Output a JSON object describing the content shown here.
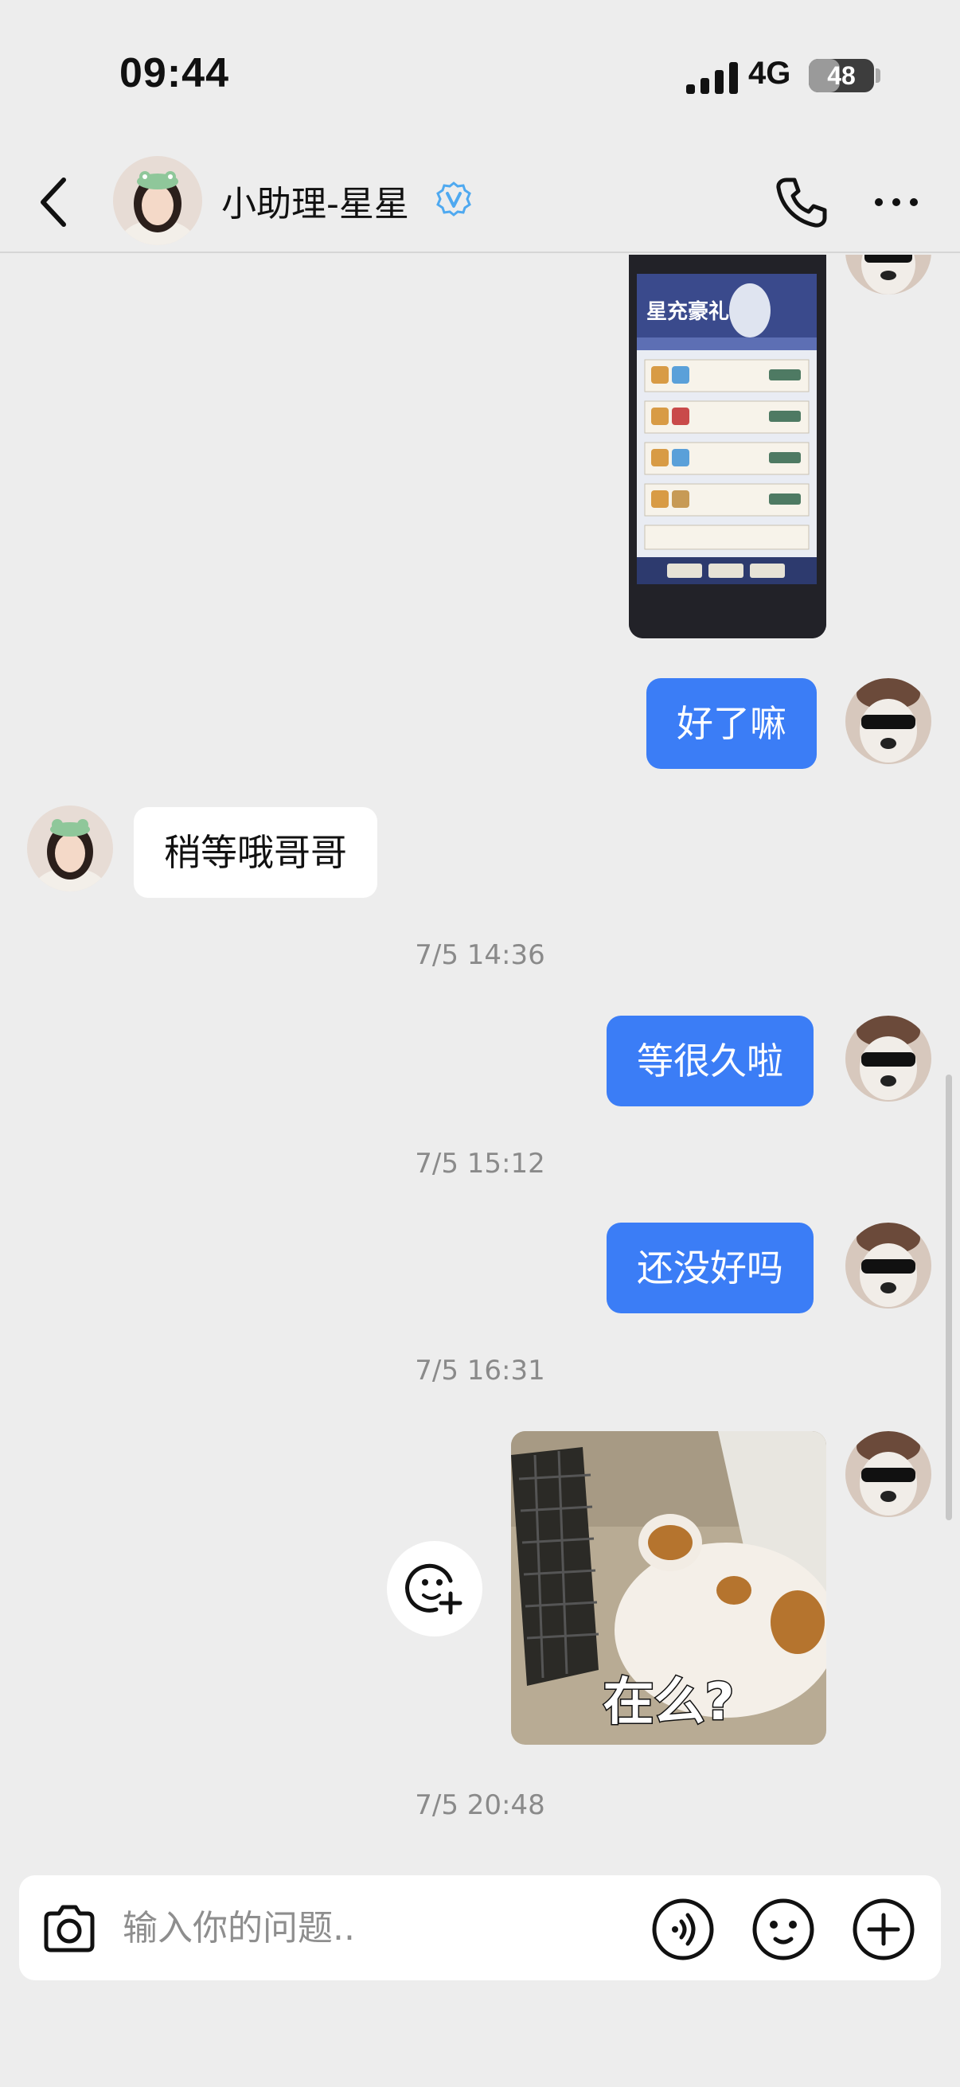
{
  "status_bar": {
    "time": "09:44",
    "network": "4G",
    "battery_level": "48",
    "battery_fraction": 0.48
  },
  "header": {
    "title": "小助理-星星",
    "back_icon": "chevron-left-icon",
    "verified_icon": "verified-v-icon",
    "call_icon": "phone-icon",
    "more_icon": "more-dots-icon"
  },
  "messages": {
    "m1_text": "好了嘛",
    "m2_text": "稍等哦哥哥",
    "ts1": "7/5 14:36",
    "m3_text": "等很久啦",
    "ts2": "7/5 15:12",
    "m4_text": "还没好吗",
    "ts3": "7/5 16:31",
    "sticker_caption": "在么?",
    "ts4": "7/5 20:48"
  },
  "screenshot_image": {
    "title": "星充豪礼"
  },
  "input_bar": {
    "placeholder": "输入你的问题..",
    "camera_icon": "camera-icon",
    "voice_icon": "voice-icon",
    "emoji_icon": "emoji-icon",
    "plus_icon": "plus-circle-icon"
  },
  "colors": {
    "my_bubble": "#3b7df6",
    "their_bubble": "#ffffff",
    "background": "#ededed",
    "verified": "#4fa9f0"
  }
}
